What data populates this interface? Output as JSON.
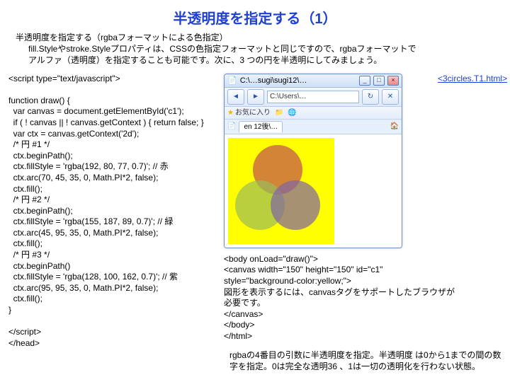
{
  "title": "半透明度を指定する（1）",
  "intro": {
    "line1": "半透明度を指定する（rgbaフォーマットによる色指定）",
    "line2": "fill.Styleやstroke.Styleプロパティは、CSSの色指定フォーマットと同じですので、rgbaフォーマットで",
    "line3": "アルファ（透明度）を指定することも可能です。次に、3 つの円を半透明にしてみましょう。"
  },
  "code_left": "<script type=\"text/javascript\">\n\nfunction draw() {\n  var canvas = document.getElementById('c1');\n  if ( ! canvas || ! canvas.getContext ) { return false; }\n  var ctx = canvas.getContext('2d');\n  /* 円 #1 */\n  ctx.beginPath();\n  ctx.fillStyle = 'rgba(192, 80, 77, 0.7)'; // 赤\n  ctx.arc(70, 45, 35, 0, Math.PI*2, false);\n  ctx.fill();\n  /* 円 #2 */\n  ctx.beginPath();\n  ctx.fillStyle = 'rgba(155, 187, 89, 0.7)'; // 緑\n  ctx.arc(45, 95, 35, 0, Math.PI*2, false);\n  ctx.fill();\n  /* 円 #3 */\n  ctx.beginPath()\n  ctx.fillStyle = 'rgba(128, 100, 162, 0.7)'; // 紫\n  ctx.arc(95, 95, 35, 0, Math.PI*2, false);\n  ctx.fill();\n}\n\n</script>\n</head>",
  "browser": {
    "title_text": "C:\\…sugi\\sugi12\\… ",
    "url_text": "C:\\Users\\…",
    "tab_text": "en 12後\\…"
  },
  "link_text": "<3circles.T1.html>",
  "code_right": "<body onLoad=\"draw()\">\n<canvas width=\"150\" height=\"150\" id=\"c1\"\nstyle=\"background-color:yellow;\">\n図形を表示するには、canvasタグをサポートしたブラウザが\n必要です。\n</canvas>\n</body>\n</html>",
  "note": "rgbaの4番目の引数に半透明度を指定。半透明度\nは0から1までの間の数字を指定。0は完全な透明36\n、1は一切の透明化を行わない状態。"
}
